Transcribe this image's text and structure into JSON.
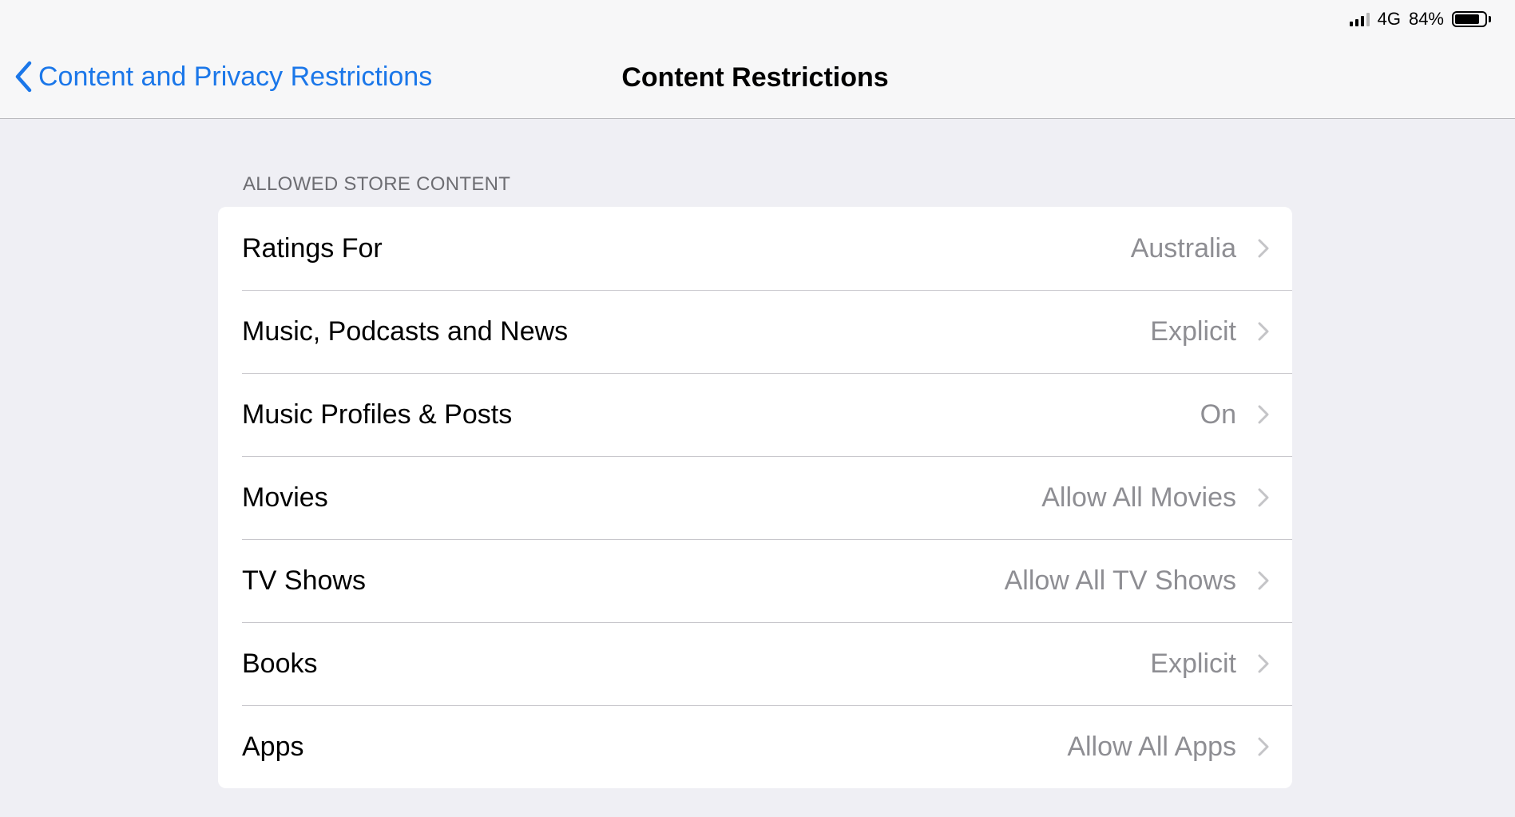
{
  "status_bar": {
    "network": "4G",
    "battery": "84%",
    "battery_level": 0.84,
    "signal_bars": 3
  },
  "nav": {
    "back_label": "Content and Privacy Restrictions",
    "title": "Content Restrictions"
  },
  "section": {
    "header": "ALLOWED STORE CONTENT",
    "rows": [
      {
        "label": "Ratings For",
        "value": "Australia"
      },
      {
        "label": "Music, Podcasts and News",
        "value": "Explicit"
      },
      {
        "label": "Music Profiles & Posts",
        "value": "On"
      },
      {
        "label": "Movies",
        "value": "Allow All Movies"
      },
      {
        "label": "TV Shows",
        "value": "Allow All TV Shows"
      },
      {
        "label": "Books",
        "value": "Explicit"
      },
      {
        "label": "Apps",
        "value": "Allow All Apps"
      }
    ]
  },
  "colors": {
    "accent": "#1b77e9",
    "background": "#efeff4",
    "secondary_text": "#8e8e93",
    "separator": "#c8c7cc"
  },
  "icons": {
    "back": "chevron-left-icon",
    "disclosure": "chevron-right-icon",
    "signal": "cellular-signal-icon",
    "battery": "battery-icon"
  }
}
